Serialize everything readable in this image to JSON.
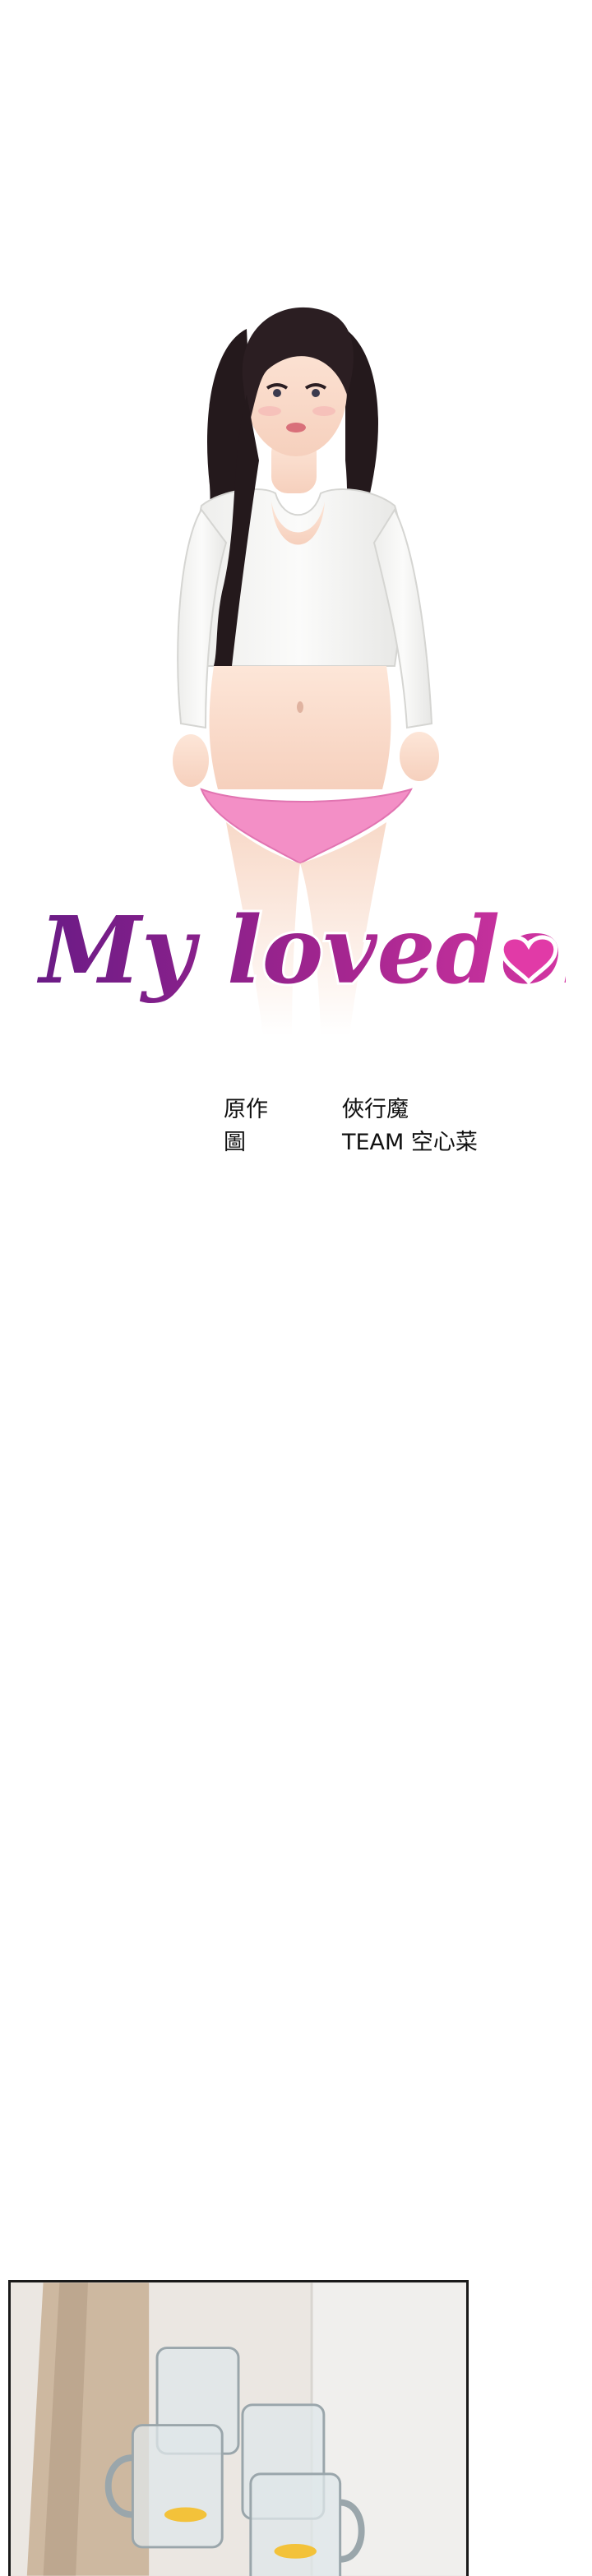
{
  "cover": {
    "title": "My lovedoll",
    "colors": {
      "title_gradient_start": "#6a1b86",
      "title_gradient_mid": "#a2258f",
      "title_gradient_end": "#e13aa7",
      "shirt": "#f4f4f2",
      "underwear": "#f38fc6",
      "hair": "#24191c"
    }
  },
  "credits": {
    "rows": [
      {
        "role": "原作",
        "name": "俠行魔"
      },
      {
        "role": "圖",
        "name": "TEAM 空心菜"
      }
    ]
  },
  "panel": {
    "contents": "glass-mugs-on-floor"
  }
}
